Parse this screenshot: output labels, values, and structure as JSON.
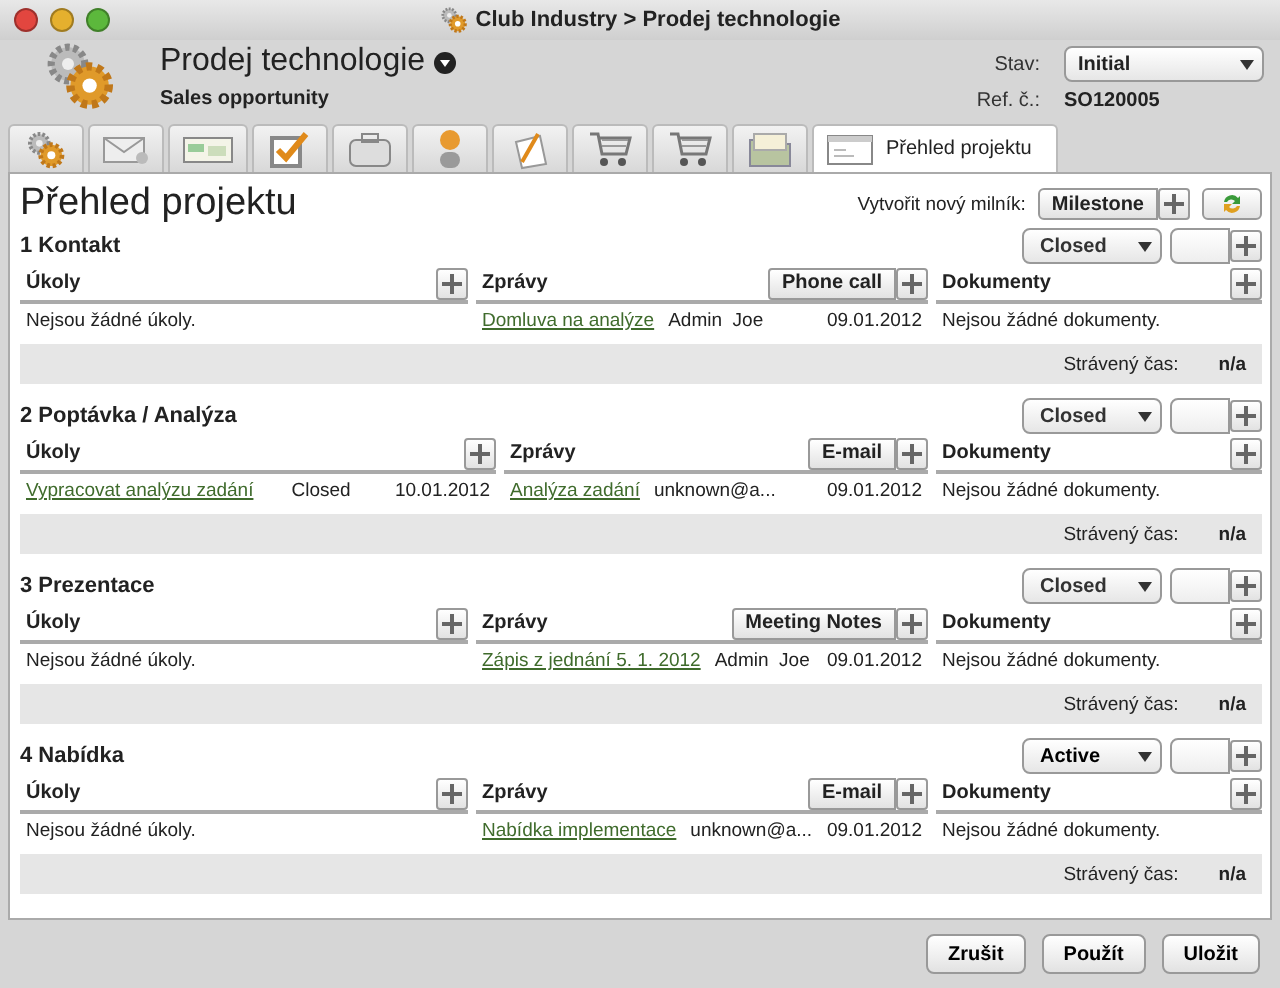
{
  "window": {
    "title": "Club Industry > Prodej technologie"
  },
  "header": {
    "title": "Prodej technologie",
    "subtitle": "Sales opportunity",
    "status_label": "Stav:",
    "status_value": "Initial",
    "ref_label": "Ref. č.:",
    "ref_value": "SO120005"
  },
  "tabs": [
    {
      "kind": "gears",
      "selected": false
    },
    {
      "kind": "mail",
      "selected": false
    },
    {
      "kind": "screen",
      "selected": false
    },
    {
      "kind": "check",
      "selected": false
    },
    {
      "kind": "case",
      "selected": false
    },
    {
      "kind": "person",
      "selected": false
    },
    {
      "kind": "pen",
      "selected": false
    },
    {
      "kind": "cart",
      "selected": false
    },
    {
      "kind": "cart",
      "selected": false
    },
    {
      "kind": "folder",
      "selected": false
    },
    {
      "kind": "overview",
      "label": "Přehled projektu",
      "selected": true
    }
  ],
  "page": {
    "title": "Přehled projektu",
    "new_label": "Vytvořit nový milník:",
    "new_button": "Milestone"
  },
  "milestones": [
    {
      "title": "1 Kontakt",
      "status": "Closed",
      "tasks_header": "Úkoly",
      "tasks_empty": "Nejsou žádné úkoly.",
      "messages_header": "Zprávy",
      "message_type": "Phone call",
      "messages": [
        {
          "subject": "Domluva na analýze",
          "sender": "Admin  Joe",
          "date": "09.01.2012"
        }
      ],
      "documents_header": "Dokumenty",
      "documents_empty": "Nejsou žádné dokumenty.",
      "spent_label": "Strávený čas:",
      "spent_value": "n/a"
    },
    {
      "title": "2 Poptávka / Analýza",
      "status": "Closed",
      "tasks_header": "Úkoly",
      "tasks": [
        {
          "title": "Vypracovat analýzu zadání",
          "status": "Closed",
          "date": "10.01.2012"
        }
      ],
      "messages_header": "Zprávy",
      "message_type": "E-mail",
      "messages": [
        {
          "subject": "Analýza zadání",
          "sender": "unknown@a...",
          "date": "09.01.2012"
        }
      ],
      "documents_header": "Dokumenty",
      "documents_empty": "Nejsou žádné dokumenty.",
      "spent_label": "Strávený čas:",
      "spent_value": "n/a"
    },
    {
      "title": "3 Prezentace",
      "status": "Closed",
      "tasks_header": "Úkoly",
      "tasks_empty": "Nejsou žádné úkoly.",
      "messages_header": "Zprávy",
      "message_type": "Meeting Notes",
      "messages": [
        {
          "subject": "Zápis z jednání 5. 1. 2012",
          "sender": "Admin  Joe",
          "date": "09.01.2012"
        }
      ],
      "documents_header": "Dokumenty",
      "documents_empty": "Nejsou žádné dokumenty.",
      "spent_label": "Strávený čas:",
      "spent_value": "n/a"
    },
    {
      "title": "4 Nabídka",
      "status": "Active",
      "tasks_header": "Úkoly",
      "tasks_empty": "Nejsou žádné úkoly.",
      "messages_header": "Zprávy",
      "message_type": "E-mail",
      "messages": [
        {
          "subject": "Nabídka implementace",
          "sender": "unknown@a...",
          "date": "09.01.2012"
        }
      ],
      "documents_header": "Dokumenty",
      "documents_empty": "Nejsou žádné dokumenty.",
      "spent_label": "Strávený čas:",
      "spent_value": "n/a"
    }
  ],
  "footer": {
    "buttons": [
      "Zrušit",
      "Použít",
      "Uložit"
    ]
  }
}
